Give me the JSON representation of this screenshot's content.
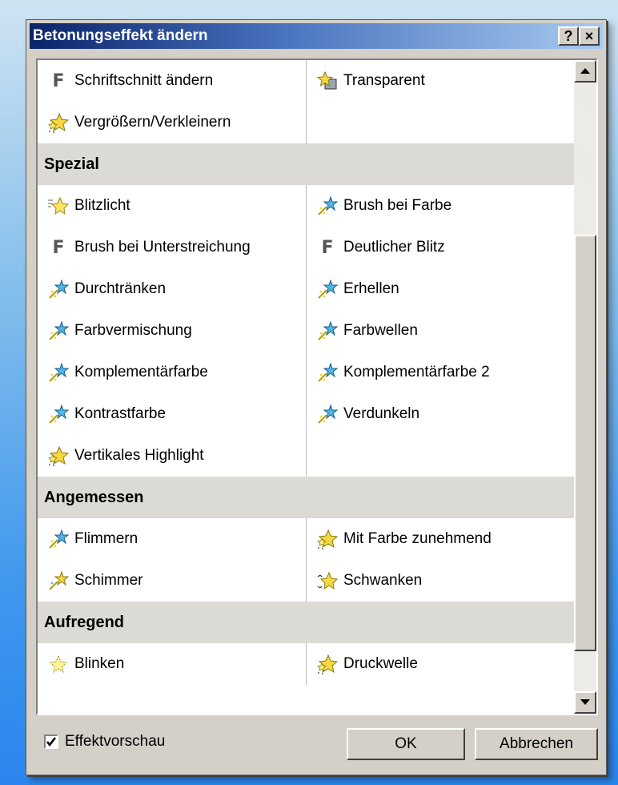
{
  "dialog": {
    "title": "Betonungseffekt ändern",
    "help_label": "?",
    "close_label": "×"
  },
  "list": {
    "rows": [
      {
        "type": "items",
        "left": {
          "label": "Schriftschnitt ändern",
          "icon": "font-f-icon"
        },
        "right": {
          "label": "Transparent",
          "icon": "transparent-star-icon"
        }
      },
      {
        "type": "items",
        "left": {
          "label": "Vergrößern/Verkleinern",
          "icon": "sparkle-gold-icon"
        },
        "right": null
      },
      {
        "type": "section",
        "label": "Spezial"
      },
      {
        "type": "items",
        "left": {
          "label": "Blitzlicht",
          "icon": "flash-star-icon"
        },
        "right": {
          "label": "Brush bei Farbe",
          "icon": "blue-star-wand-icon"
        }
      },
      {
        "type": "items",
        "left": {
          "label": "Brush bei Unterstreichung",
          "icon": "font-f-icon"
        },
        "right": {
          "label": "Deutlicher Blitz",
          "icon": "font-f-icon"
        }
      },
      {
        "type": "items",
        "left": {
          "label": "Durchtränken",
          "icon": "blue-star-wand-icon"
        },
        "right": {
          "label": "Erhellen",
          "icon": "blue-star-wand-icon"
        }
      },
      {
        "type": "items",
        "left": {
          "label": "Farbvermischung",
          "icon": "blue-star-wand-icon"
        },
        "right": {
          "label": "Farbwellen",
          "icon": "blue-star-wand-icon"
        }
      },
      {
        "type": "items",
        "left": {
          "label": "Komplementärfarbe",
          "icon": "blue-star-wand-icon"
        },
        "right": {
          "label": "Komplementärfarbe 2",
          "icon": "blue-star-wand-icon"
        }
      },
      {
        "type": "items",
        "left": {
          "label": "Kontrastfarbe",
          "icon": "blue-star-wand-icon"
        },
        "right": {
          "label": "Verdunkeln",
          "icon": "blue-star-wand-icon"
        }
      },
      {
        "type": "items",
        "left": {
          "label": "Vertikales Highlight",
          "icon": "sparkle-gold-icon"
        },
        "right": null
      },
      {
        "type": "section",
        "label": "Angemessen"
      },
      {
        "type": "items",
        "left": {
          "label": "Flimmern",
          "icon": "blue-star-wand-icon"
        },
        "right": {
          "label": "Mit Farbe zunehmend",
          "icon": "sparkle-gold-icon"
        }
      },
      {
        "type": "items",
        "left": {
          "label": "Schimmer",
          "icon": "gold-star-wand-icon"
        },
        "right": {
          "label": "Schwanken",
          "icon": "wobble-star-icon"
        }
      },
      {
        "type": "section",
        "label": "Aufregend"
      },
      {
        "type": "items",
        "left": {
          "label": "Blinken",
          "icon": "blink-star-icon"
        },
        "right": {
          "label": "Druckwelle",
          "icon": "sparkle-gold-icon"
        }
      }
    ]
  },
  "footer": {
    "preview_label": "Effektvorschau",
    "preview_checked": true,
    "ok_label": "OK",
    "cancel_label": "Abbrechen"
  },
  "colors": {
    "titlebar_start": "#0a246a",
    "titlebar_end": "#a6caf0",
    "section_bg": "#dcdad5",
    "dialog_bg": "#d4d0c8"
  }
}
